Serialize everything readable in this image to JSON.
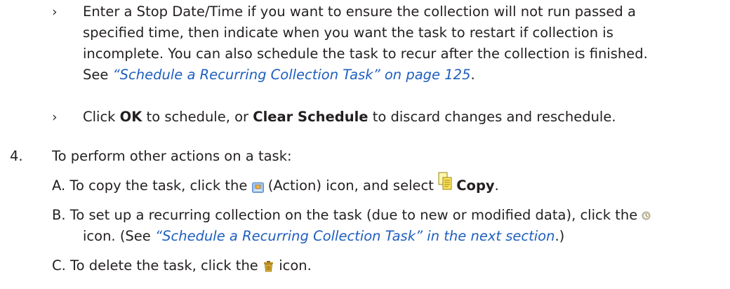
{
  "bullets": [
    {
      "marker": "›",
      "line1": "Enter a Stop Date/Time if you want to ensure the collection will not run passed a",
      "line2": "specified time, then indicate when you want the task to restart if collection is",
      "line3": "incomplete. You can also schedule the task to recur after the collection is finished.",
      "line4_prefix": "See ",
      "line4_link": "“Schedule a Recurring Collection Task” on page 125",
      "line4_suffix": "."
    },
    {
      "marker": "›",
      "t1": "Click ",
      "b1": "OK",
      "t2": " to schedule, or ",
      "b2": "Clear Schedule",
      "t3": " to discard changes and reschedule."
    }
  ],
  "step4": {
    "number": "4.",
    "text": "To perform other actions on a task:"
  },
  "substeps": {
    "a": {
      "label": "A.",
      "t1": "To copy the task, click the ",
      "t2": " (Action) icon, and select ",
      "bold": "Copy",
      "t3": "."
    },
    "b": {
      "label": "B.",
      "t1": "To set up a recurring collection on the task (due to new or modified data), click the",
      "t2": "icon. (See ",
      "link": "“Schedule a Recurring Collection Task” in the next section",
      "t3": ".)"
    },
    "c": {
      "label": "C.",
      "t1": "To delete the task, click the ",
      "t2": " icon."
    }
  },
  "icons": {
    "action": "action-icon",
    "copy": "copy-icon",
    "clock": "clock-icon",
    "trash": "trash-icon"
  },
  "colors": {
    "text": "#231f20",
    "link": "#1f5fbf"
  }
}
